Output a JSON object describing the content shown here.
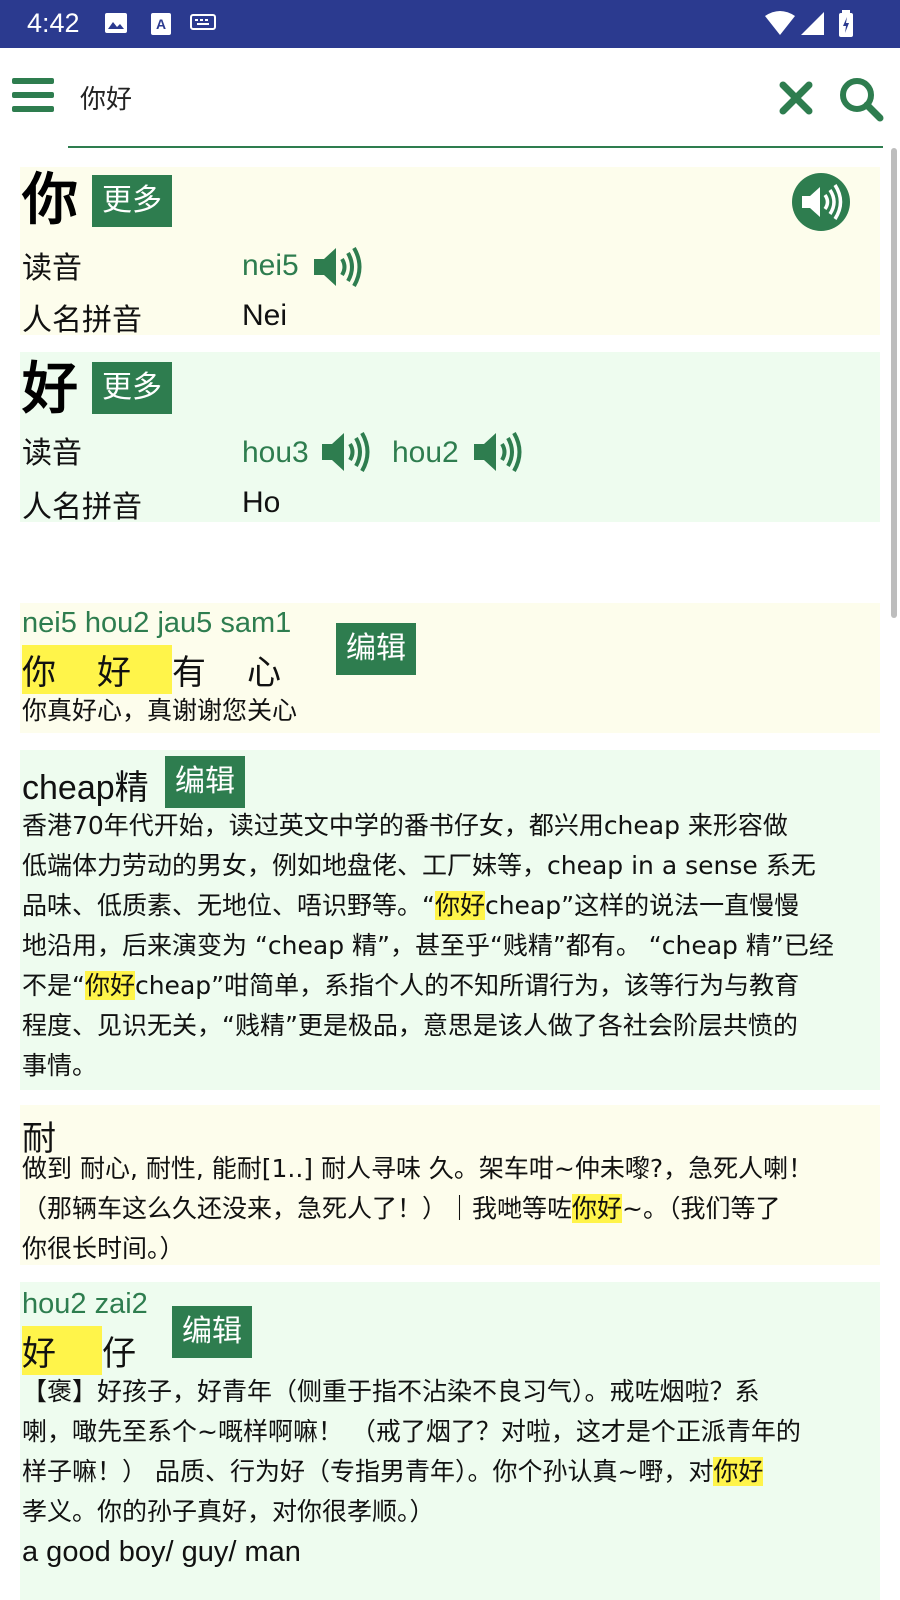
{
  "status_bar": {
    "time": "4:42",
    "icons": [
      "image-icon",
      "text-a-icon",
      "keyboard-icon",
      "wifi-icon",
      "signal-icon",
      "battery-icon"
    ]
  },
  "search": {
    "value": "你好"
  },
  "colors": {
    "accent": "#2e7d4f",
    "status_bar": "#2b3a8f",
    "highlight": "#fff44a",
    "card_yellow": "#fdfdec",
    "card_green": "#eefcef"
  },
  "chars": [
    {
      "char": "你",
      "more_label": "更多",
      "reading_label": "读音",
      "readings": [
        "nei5"
      ],
      "name_pinyin_label": "人名拼音",
      "name_pinyin": "Nei"
    },
    {
      "char": "好",
      "more_label": "更多",
      "reading_label": "读音",
      "readings": [
        "hou3",
        "hou2"
      ],
      "name_pinyin_label": "人名拼音",
      "name_pinyin": "Ho"
    }
  ],
  "entries": {
    "e1": {
      "jyutping": "nei5 hou2 jau5 sam1",
      "chars": [
        "你",
        "好",
        "有",
        "心"
      ],
      "edit_label": "编辑",
      "definition": "你真好心，真谢谢您关心"
    },
    "e2": {
      "headword": "cheap精",
      "edit_label": "编辑",
      "l1": "香港70年代开始，读过英文中学的番书仔女，都兴用cheap 来形容做",
      "l2": "低端体力劳动的男女，例如地盘佬、工厂妹等，cheap in a sense 系无",
      "l3a": "品味、低质素、无地位、唔识野等。“",
      "l3hl": "你好",
      "l3b": "cheap”这样的说法一直慢慢",
      "l4": "地沿用，后来演变为 “cheap 精”，甚至乎“贱精”都有。 “cheap 精”已经",
      "l5a": "不是“",
      "l5hl": "你好",
      "l5b": "cheap”咁简单，系指个人的不知所谓行为，该等行为与教育",
      "l6": "程度、见识无关，“贱精”更是极品，意思是该人做了各社会阶层共愤的",
      "l7": "事情。"
    },
    "e3": {
      "headword": "耐",
      "l1": "做到 耐心, 耐性, 能耐[1..] 耐人寻味 久。架车咁~仲未嚟?，急死人喇！",
      "l2a": "（那辆车这么久还没来，急死人了！）｜我哋等咗",
      "l2hl": "你好",
      "l2b": "~。（我们等了",
      "l3": "你很长时间。）"
    },
    "e4": {
      "jyutping": "hou2 zai2",
      "chars": [
        "好",
        "仔"
      ],
      "edit_label": "编辑",
      "l1": "【褒】好孩子，好青年（侧重于指不沾染不良习气）。戒咗烟啦？系",
      "l2": "喇，噉先至系个~嘅样啊嘛！ （戒了烟了？对啦，这才是个正派青年的",
      "l3a": "样子嘛！） 品质、行为好（专指男青年）。你个孙认真~嘢，对",
      "l3hl": "你好",
      "l4": "孝义。你的孙子真好，对你很孝顺。）",
      "l5": "a good boy/ guy/ man"
    }
  }
}
